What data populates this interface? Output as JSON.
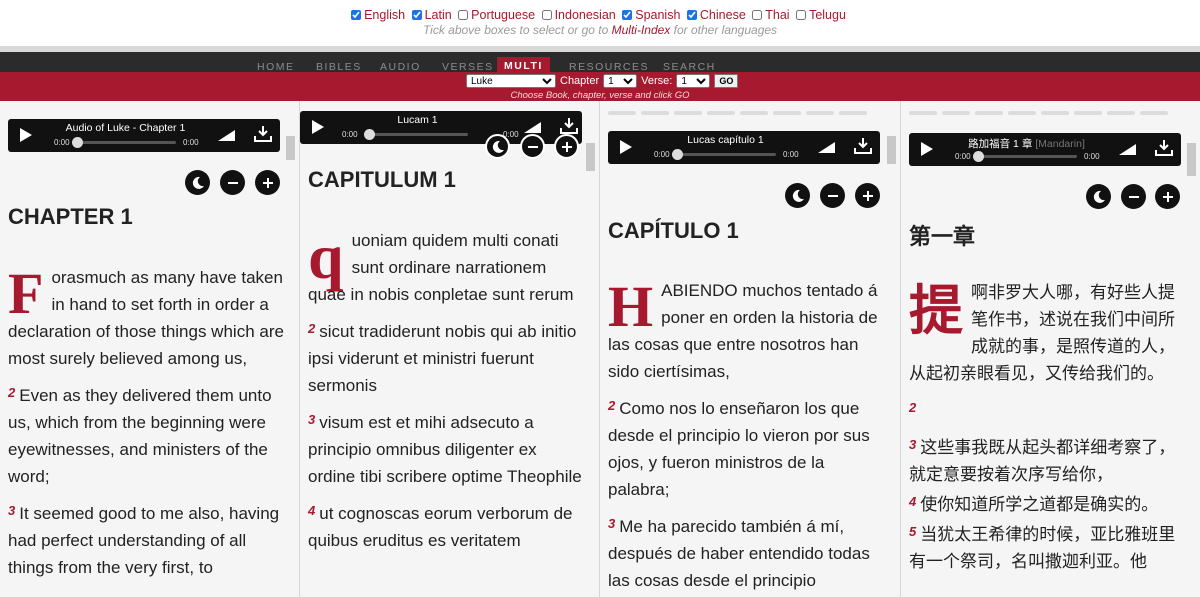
{
  "languages": [
    {
      "name": "English",
      "checked": true
    },
    {
      "name": "Latin",
      "checked": true
    },
    {
      "name": "Portuguese",
      "checked": false
    },
    {
      "name": "Indonesian",
      "checked": false
    },
    {
      "name": "Spanish",
      "checked": true
    },
    {
      "name": "Chinese",
      "checked": true
    },
    {
      "name": "Thai",
      "checked": false
    },
    {
      "name": "Telugu",
      "checked": false
    }
  ],
  "lang_hint": {
    "before": "Tick above boxes to select or go to",
    "link": "Multi-Index",
    "after": "for other languages"
  },
  "nav": {
    "home": "HOME",
    "bibles": "BIBLES",
    "audio": "AUDIO",
    "verses": "VERSES",
    "multi": "MULTI",
    "resources": "RESOURCES",
    "search": "SEARCH"
  },
  "selector": {
    "book": "Luke",
    "chapter_label": "Chapter",
    "chapter": "1",
    "verse_label": "Verse:",
    "verse": "1",
    "go": "GO",
    "hint": "Choose Book, chapter, verse and click GO"
  },
  "columns": [
    {
      "audio_title": "Audio of Luke - Chapter 1",
      "time_start": "0:00",
      "time_end": "0:00",
      "chapter_title": "CHAPTER 1",
      "drop_cap": "F",
      "verse1": "orasmuch as many have taken in hand to set forth in order a declaration of those things which are most surely believed among us,",
      "verses": [
        {
          "n": "2",
          "text": "Even as they delivered them unto us, which from the beginning were eyewitnesses, and ministers of the word;"
        },
        {
          "n": "3",
          "text": "It seemed good to me also, having had perfect understanding of all things from the very first, to"
        }
      ]
    },
    {
      "audio_title": "Lucam 1",
      "time_start": "0:00",
      "time_end": "0:00",
      "chapter_title": "CAPITULUM 1",
      "drop_cap": "q",
      "verse1": "uoniam quidem multi conati sunt ordinare narrationem quae in nobis conpletae sunt rerum",
      "verses": [
        {
          "n": "2",
          "text": "sicut tradiderunt nobis qui ab initio ipsi viderunt et ministri fuerunt sermonis"
        },
        {
          "n": "3",
          "text": "visum est et mihi adsecuto a principio omnibus diligenter ex ordine tibi scribere optime Theophile"
        },
        {
          "n": "4",
          "text": "ut cognoscas eorum verborum de quibus eruditus es veritatem"
        }
      ]
    },
    {
      "audio_title": "Lucas capítulo 1",
      "time_start": "0:00",
      "time_end": "0:00",
      "chapter_title": "CAPÍTULO 1",
      "drop_cap": "H",
      "verse1": "ABIENDO muchos tentado á poner en orden la historia de las cosas que entre nosotros han sido ciertísimas,",
      "verses": [
        {
          "n": "2",
          "text": "Como nos lo enseñaron los que desde el principio lo vieron por sus ojos, y fueron ministros de la palabra;"
        },
        {
          "n": "3",
          "text": "Me ha parecido también á mí, después de haber entendido todas las cosas desde el principio"
        }
      ]
    },
    {
      "audio_title": "路加福音 1 章",
      "audio_title_muted": "[Mandarin]",
      "time_start": "0:00",
      "time_end": "0:00",
      "chapter_title": "第一章",
      "drop_cap": "提",
      "verse1": "啊非罗大人哪，有好些人提笔作书，述说在我们中间所成就的事，是照传道的人，从起初亲眼看见，又传给我们的。",
      "verses": [
        {
          "n": "2",
          "text": ""
        },
        {
          "n": "3",
          "text": "这些事我既从起头都详细考察了，就定意要按着次序写给你，"
        },
        {
          "n": "4",
          "text": "使你知道所学之道都是确实的。"
        },
        {
          "n": "5",
          "text": "当犹太王希律的时候，亚比雅班里有一个祭司，名叫撒迦利亚。他"
        }
      ]
    }
  ],
  "colors": {
    "brand_red": "#a6192e",
    "nav_dark": "#2b2b2b",
    "column_bg": "#f5f5f5"
  }
}
